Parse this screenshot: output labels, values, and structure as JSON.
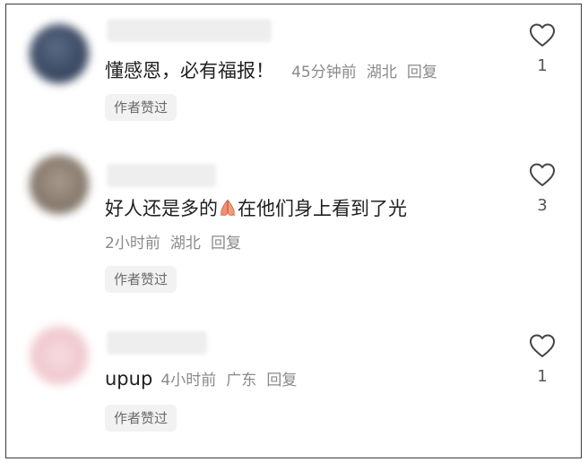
{
  "comments": [
    {
      "text": "懂感恩，必有福报！",
      "meta_time": "45分钟前",
      "meta_location": "湖北",
      "reply_label": "回复",
      "author_badge": "作者赞过",
      "like_count": "1",
      "avatar_color": "#3c4a63"
    },
    {
      "text_before": "好人还是多的",
      "text_after": "在他们身上看到了光",
      "emoji": "folded-hands-emoji",
      "meta_time": "2小时前",
      "meta_location": "湖北",
      "reply_label": "回复",
      "author_badge": "作者赞过",
      "like_count": "3",
      "avatar_color": "#8b7d70"
    },
    {
      "text": "upup",
      "meta_time": "4小时前",
      "meta_location": "广东",
      "reply_label": "回复",
      "author_badge": "作者赞过",
      "like_count": "1",
      "avatar_color": "#f0c9cf"
    }
  ],
  "icons": {
    "like": "heart-outline-icon"
  }
}
